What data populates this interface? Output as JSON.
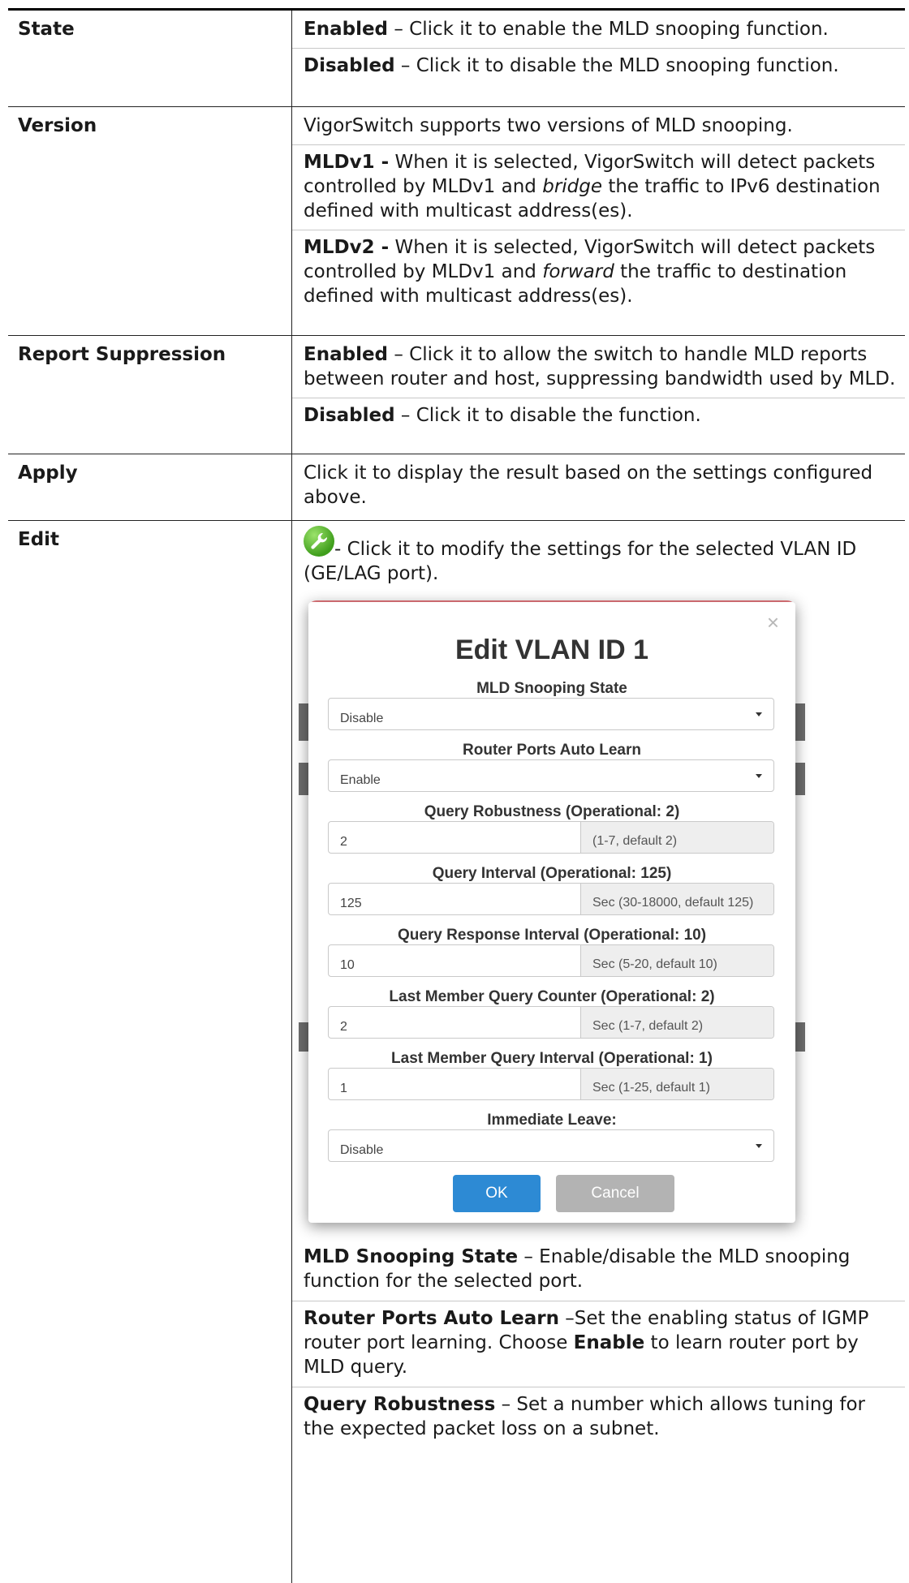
{
  "rows": {
    "state": {
      "label": "State",
      "enabled_term": "Enabled",
      "enabled_text": " – Click it to enable the MLD snooping function.",
      "disabled_term": "Disabled",
      "disabled_text": " – Click it to disable the MLD snooping function."
    },
    "version": {
      "label": "Version",
      "intro": "VigorSwitch supports two versions of MLD snooping.",
      "v1_term": "MLDv1 -",
      "v1_text_a": " When it is selected, VigorSwitch will detect packets controlled by MLDv1 and ",
      "v1_em": "bridge",
      "v1_text_b": " the traffic to IPv6 destination defined with multicast address(es).",
      "v2_term": "MLDv2 -",
      "v2_text_a": " When it is selected, VigorSwitch will detect packets controlled by MLDv1 and ",
      "v2_em": "forward",
      "v2_text_b": " the traffic to destination defined with multicast address(es)."
    },
    "report": {
      "label": "Report Suppression",
      "enabled_term": "Enabled",
      "enabled_text": " – Click it to allow the switch to handle MLD reports between router and host, suppressing bandwidth used by MLD.",
      "disabled_term": "Disabled",
      "disabled_text": " – Click it to disable the function."
    },
    "apply": {
      "label": "Apply",
      "text": "Click it to display the result based on the settings configured above."
    },
    "edit": {
      "label": "Edit",
      "icon_text": "- Click it to modify the settings for the selected VLAN ID (GE/LAG port).",
      "icon": "wrench-icon"
    }
  },
  "modal": {
    "title": "Edit VLAN ID 1",
    "close": "×",
    "mld_state_label": "MLD Snooping State",
    "mld_state_value": "Disable",
    "router_ports_label": "Router Ports Auto Learn",
    "router_ports_value": "Enable",
    "robustness_label": "Query Robustness (Operational: 2)",
    "robustness_value": "2",
    "robustness_hint": "(1-7, default 2)",
    "interval_label": "Query Interval (Operational: 125)",
    "interval_value": "125",
    "interval_hint": "Sec (30-18000, default 125)",
    "response_label": "Query Response Interval (Operational: 10)",
    "response_value": "10",
    "response_hint": "Sec (5-20, default 10)",
    "lmq_counter_label": "Last Member Query Counter (Operational: 2)",
    "lmq_counter_value": "2",
    "lmq_counter_hint": "Sec (1-7, default 2)",
    "lmq_interval_label": "Last Member Query Interval (Operational: 1)",
    "lmq_interval_value": "1",
    "lmq_interval_hint": "Sec (1-25, default 1)",
    "immediate_leave_label": "Immediate Leave:",
    "immediate_leave_value": "Disable",
    "ok": "OK",
    "cancel": "Cancel"
  },
  "tail": {
    "mld_term": "MLD Snooping State",
    "mld_text": " – Enable/disable the MLD snooping function for the selected port.",
    "router_term": "Router Ports Auto Learn",
    "router_text_a": " –Set the enabling status of IGMP router port learning. Choose ",
    "router_enable": "Enable",
    "router_text_b": " to learn router port by MLD query.",
    "robust_term": "Query Robustness",
    "robust_text": " – Set a number which allows tuning for the expected packet loss on a subnet."
  },
  "colors": {
    "ok_button": "#2d8ad4",
    "cancel_button": "#b3b3b3",
    "wrench_green": "#3f9e1c"
  }
}
